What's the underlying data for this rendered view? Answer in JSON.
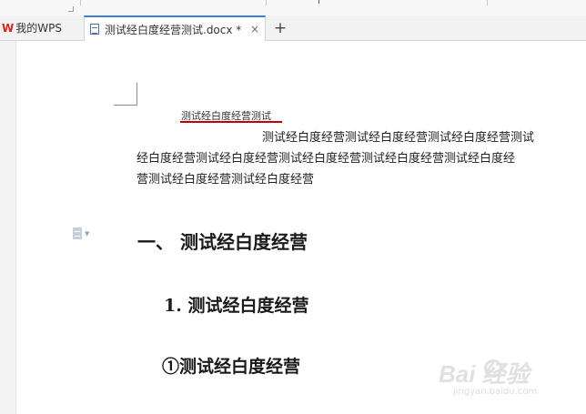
{
  "tabs": {
    "home_label": "我的WPS",
    "home_icon": "W",
    "doc_label": "测试经白度经营测试.docx *",
    "doc_close": "×",
    "add_label": "+"
  },
  "document": {
    "small_title": "测试经白度经营测试",
    "body_lines": [
      "测试经白度经营测试经白度经营测试经白度经营测试",
      "经白度经营测试经白度经营测试经白度经营测试经白度经营测试经白度经",
      "营测试经白度经营测试经白度经营"
    ],
    "heading1": "一、 测试经白度经营",
    "heading2": "1. 测试经白度经营",
    "heading3": "①测试经白度经营"
  },
  "watermark": {
    "brand": "Bai 经验",
    "url": "jingyan.baidu.com"
  },
  "colors": {
    "accent_tab": "#3c7fd6",
    "wps_red": "#d9241c",
    "underline_red": "#c00000"
  }
}
